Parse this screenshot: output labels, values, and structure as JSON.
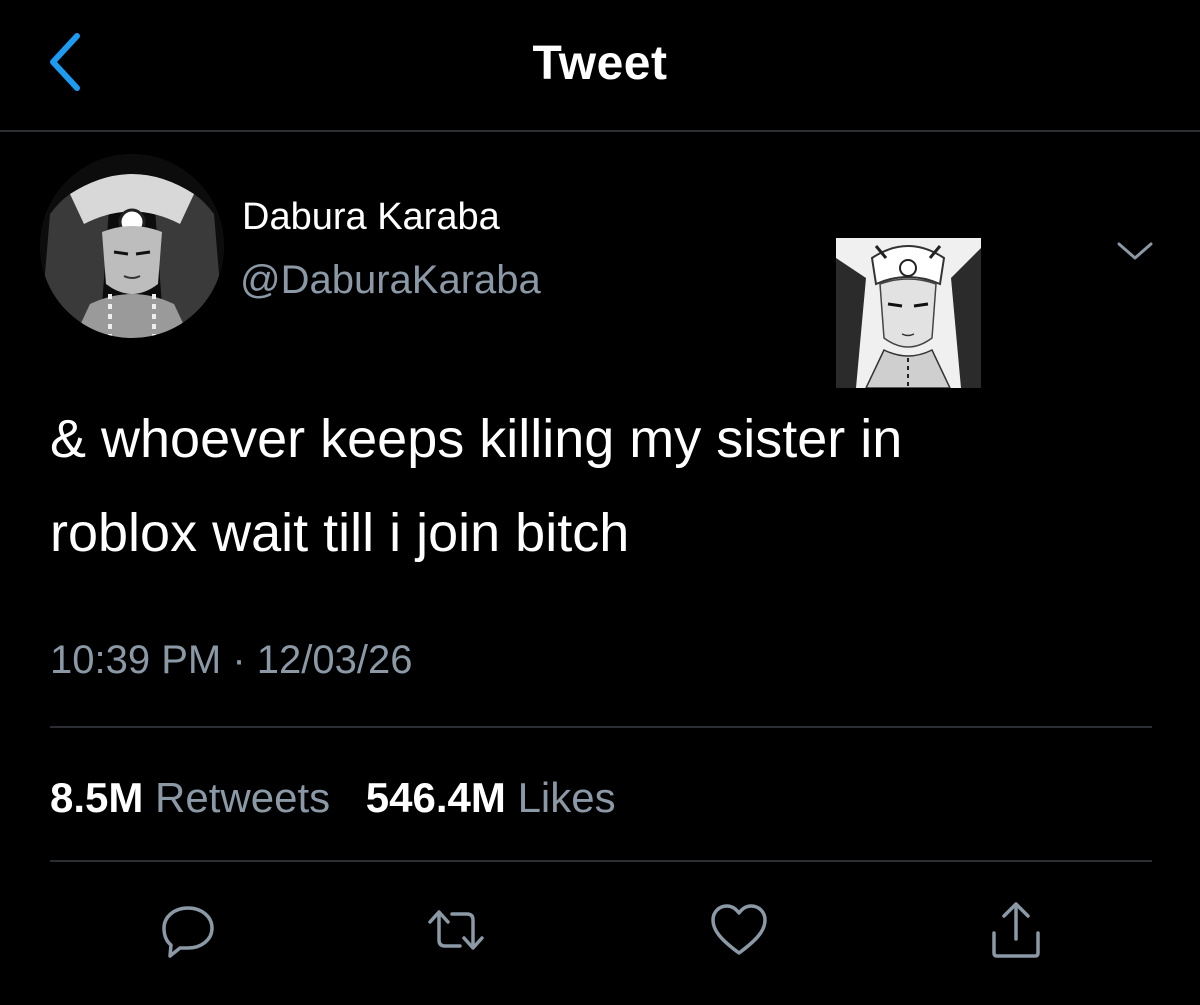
{
  "header": {
    "title": "Tweet"
  },
  "author": {
    "name": "Dabura Karaba",
    "handle": "@DaburaKaraba"
  },
  "tweet": {
    "line1": "& whoever keeps killing my sister in",
    "line2": "roblox wait till i join bitch",
    "time": "10:39 PM",
    "separator": "·",
    "date": "12/03/26"
  },
  "stats": {
    "retweets_count": "8.5M",
    "retweets_label": "Retweets",
    "likes_count": "546.4M",
    "likes_label": "Likes"
  },
  "icons": {
    "back": "chevron-left-icon",
    "more": "chevron-down-icon",
    "reply": "reply-icon",
    "retweet": "retweet-icon",
    "like": "heart-icon",
    "share": "share-icon"
  },
  "colors": {
    "background": "#000000",
    "accent": "#1d9bf0",
    "text": "#ffffff",
    "secondary_text": "#8b98a5",
    "divider": "#2a2d31"
  }
}
